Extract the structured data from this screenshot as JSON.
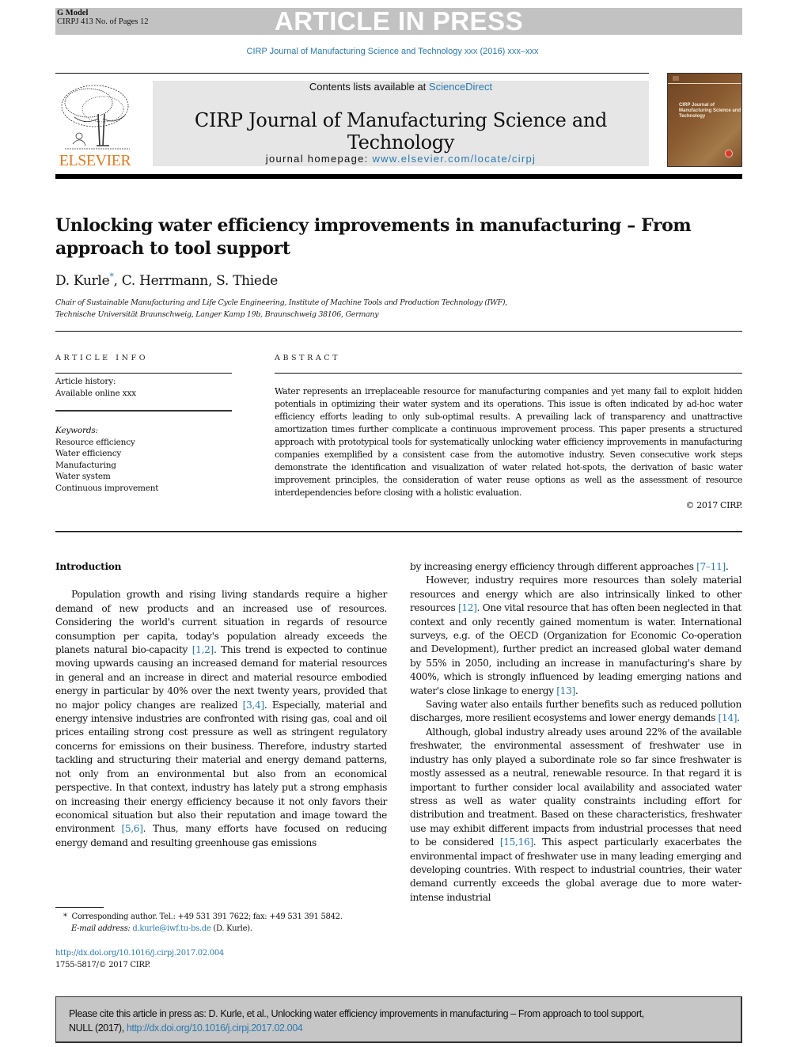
{
  "banner": {
    "model_label": "G Model",
    "model_info": "CIRPJ 413 No. of Pages 12",
    "status": "ARTICLE IN PRESS"
  },
  "journal_ref": "CIRP Journal of Manufacturing Science and Technology xxx (2016) xxx–xxx",
  "masthead": {
    "publisher": "ELSEVIER",
    "contents_prefix": "Contents lists available at ",
    "contents_link": "ScienceDirect",
    "journal_title": "CIRP Journal of Manufacturing Science and Technology",
    "homepage_prefix": "journal homepage: ",
    "homepage_link": "www.elsevier.com/locate/cirpj",
    "cover_title": "CIRP Journal of Manufacturing Science and Technology"
  },
  "article": {
    "title": "Unlocking water efficiency improvements in manufacturing – From approach to tool support",
    "authors": {
      "first": "D. Kurle",
      "star": "*",
      "rest": ", C. Herrmann, S. Thiede"
    },
    "affiliation_line1": "Chair of Sustainable Manufacturing and Life Cycle Engineering, Institute of Machine Tools and Production Technology (IWF),",
    "affiliation_line2": "Technische Universität Braunschweig, Langer Kamp 19b, Braunschweig 38106, Germany"
  },
  "article_info": {
    "heading": "ARTICLE INFO",
    "history_label": "Article history:",
    "history_value": "Available online xxx",
    "keywords_label": "Keywords:",
    "keywords": [
      "Resource efficiency",
      "Water efficiency",
      "Manufacturing",
      "Water system",
      "Continuous improvement"
    ]
  },
  "abstract": {
    "heading": "ABSTRACT",
    "text": "Water represents an irreplaceable resource for manufacturing companies and yet many fail to exploit hidden potentials in optimizing their water system and its operations. This issue is often indicated by ad-hoc water efficiency efforts leading to only sub-optimal results. A prevailing lack of transparency and unattractive amortization times further complicate a continuous improvement process. This paper presents a structured approach with prototypical tools for systematically unlocking water efficiency improvements in manufacturing companies exemplified by a consistent case from the automotive industry. Seven consecutive work steps demonstrate the identification and visualization of water related hot-spots, the derivation of basic water improvement principles, the consideration of water reuse options as well as the assessment of resource interdependencies before closing with a holistic evaluation.",
    "copyright": "© 2017 CIRP."
  },
  "body": {
    "section_heading": "Introduction",
    "left_p1": [
      "Population growth and rising living standards require a higher demand of new products and an increased use of resources. Considering the world's current situation in regards of resource consumption per capita, today's population already exceeds the planets natural bio-capacity ",
      "[1,2]",
      ". This trend is expected to continue moving upwards causing an increased demand for material resources in general and an increase in direct and material resource embodied energy in particular by 40% over the next twenty years, provided that no major policy changes are realized ",
      "[3,4]",
      ". Especially, material and energy intensive industries are confronted with rising gas, coal and oil prices entailing strong cost pressure as well as stringent regulatory concerns for emissions on their business. Therefore, industry started tackling and structuring their material and energy demand patterns, not only from an environmental but also from an economical perspective. In that context, industry has lately put a strong emphasis on increasing their energy efficiency because it not only favors their economical situation but also their reputation and image toward the environment ",
      "[5,6]",
      ". Thus, many efforts have focused on reducing energy demand and resulting greenhouse gas emissions"
    ],
    "right_p0": [
      "by increasing energy efficiency through different approaches ",
      "[7–11]",
      "."
    ],
    "right_p1": [
      "However, industry requires more resources than solely material resources and energy which are also intrinsically linked to other resources ",
      "[12]",
      ". One vital resource that has often been neglected in that context and only recently gained momentum is water. International surveys, e.g. of the OECD (Organization for Economic Co-operation and Development), further predict an increased global water demand by 55% in 2050, including an increase in manufacturing's share by 400%, which is strongly influenced by leading emerging nations and water's close linkage to energy ",
      "[13]",
      "."
    ],
    "right_p2": [
      "Saving water also entails further benefits such as reduced pollution discharges, more resilient ecosystems and lower energy demands ",
      "[14]",
      "."
    ],
    "right_p3": [
      "Although, global industry already uses around 22% of the available freshwater, the environmental assessment of freshwater use in industry has only played a subordinate role so far since freshwater is mostly assessed as a neutral, renewable resource. In that regard it is important to further consider local availability and associated water stress as well as water quality constraints including effort for distribution and treatment. Based on these characteristics, freshwater use may exhibit different impacts from industrial processes that need to be considered ",
      "[15,16]",
      ". This aspect particularly exacerbates the environmental impact of freshwater use in many leading emerging and developing countries. With respect to industrial countries, their water demand currently exceeds the global average due to more water-intense industrial"
    ]
  },
  "footnote": {
    "star": "*",
    "corresponding": "Corresponding author. Tel.: +49 531 391 7622; fax: +49 531 391 5842.",
    "email_label": "E-mail address:",
    "email": "d.kurle@iwf.tu-bs.de",
    "email_suffix": " (D.  Kurle)."
  },
  "doi": {
    "link": "http://dx.doi.org/10.1016/j.cirpj.2017.02.004",
    "issn": "1755-5817/© 2017 CIRP."
  },
  "cite_box": {
    "text_line1": "Please cite this article in press as: D. Kurle, et al., Unlocking water efficiency improvements in manufacturing – From approach to tool support,",
    "text_line2_prefix": "NULL (2017), ",
    "link": "http://dx.doi.org/10.1016/j.cirpj.2017.02.004"
  },
  "colors": {
    "link": "#2a7ab0",
    "publisher_orange": "#e67a1e",
    "banner_gray": "#c2c2c2",
    "masthead_gray": "#e6e6e6"
  }
}
